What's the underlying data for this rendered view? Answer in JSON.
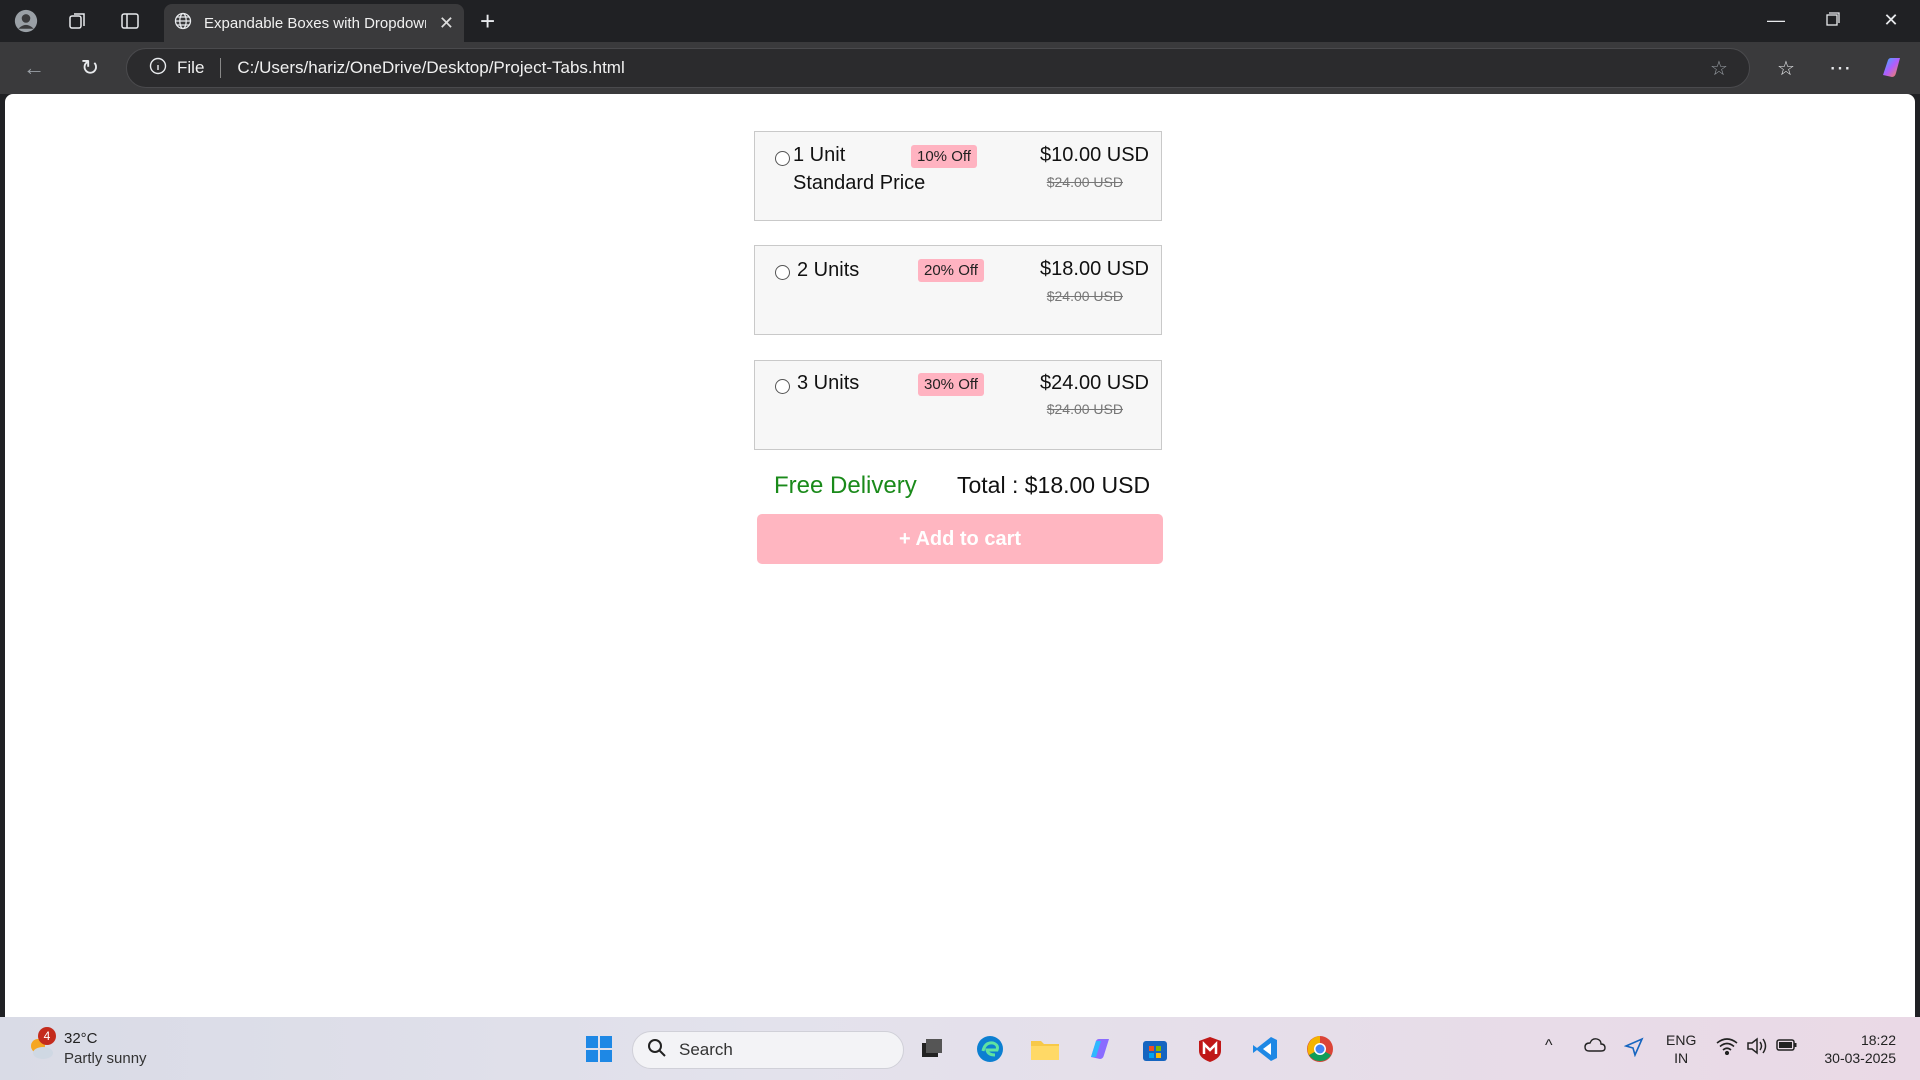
{
  "browser": {
    "tab_title": "Expandable Boxes with Dropdown",
    "address_scheme": "File",
    "address_url": "C:/Users/hariz/OneDrive/Desktop/Project-Tabs.html"
  },
  "offers": [
    {
      "label": "1 Unit",
      "subtitle": "Standard Price",
      "badge": "10% Off",
      "price": "$10.00 USD",
      "old_price": "$24.00 USD",
      "selected": false
    },
    {
      "label": "2 Units",
      "subtitle": "",
      "badge": "20% Off",
      "price": "$18.00 USD",
      "old_price": "$24.00 USD",
      "selected": false
    },
    {
      "label": "3 Units",
      "subtitle": "",
      "badge": "30% Off",
      "price": "$24.00 USD",
      "old_price": "$24.00 USD",
      "selected": false
    }
  ],
  "summary": {
    "delivery": "Free Delivery",
    "total": "Total : $18.00 USD",
    "add_to_cart": "+ Add to cart"
  },
  "colors": {
    "badge": "#ffb3c1",
    "delivery": "#1a8a1a",
    "cart_button": "#ffb6c1"
  },
  "taskbar": {
    "weather_badge": "4",
    "weather_temp": "32°C",
    "weather_desc": "Partly sunny",
    "search_placeholder": "Search",
    "lang_line1": "ENG",
    "lang_line2": "IN",
    "time": "18:22",
    "date": "30-03-2025"
  }
}
